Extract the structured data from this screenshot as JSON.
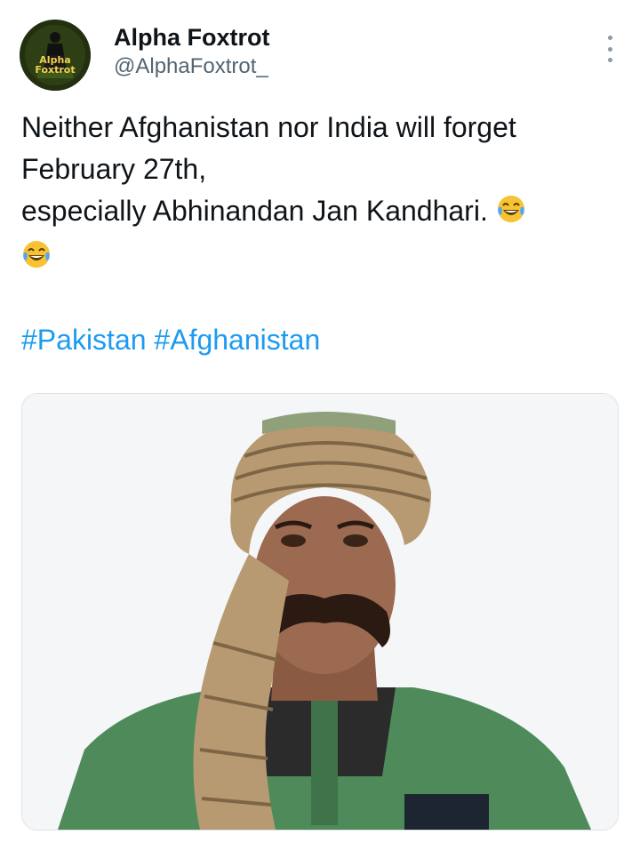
{
  "tweet": {
    "author": {
      "display_name": "Alpha Foxtrot",
      "handle": "@AlphaFoxtrot_",
      "avatar_text_line1": "Alpha",
      "avatar_text_line2": "Foxtrot"
    },
    "text_lines": [
      "Neither Afghanistan nor India will forget February 27th,",
      "especially Abhinandan Jan Kandhari."
    ],
    "emoji": "tears-of-joy",
    "hashtags": [
      "#Pakistan",
      "#Afghanistan"
    ]
  },
  "colors": {
    "hashtag": "#1d9bf0",
    "handle": "#536471",
    "text": "#0f1419",
    "avatar_bg": "#1f2a12",
    "avatar_text": "#f2d24a"
  },
  "icons": {
    "more": "more-vertical-icon",
    "emoji": "tears-of-joy-emoji-icon"
  }
}
